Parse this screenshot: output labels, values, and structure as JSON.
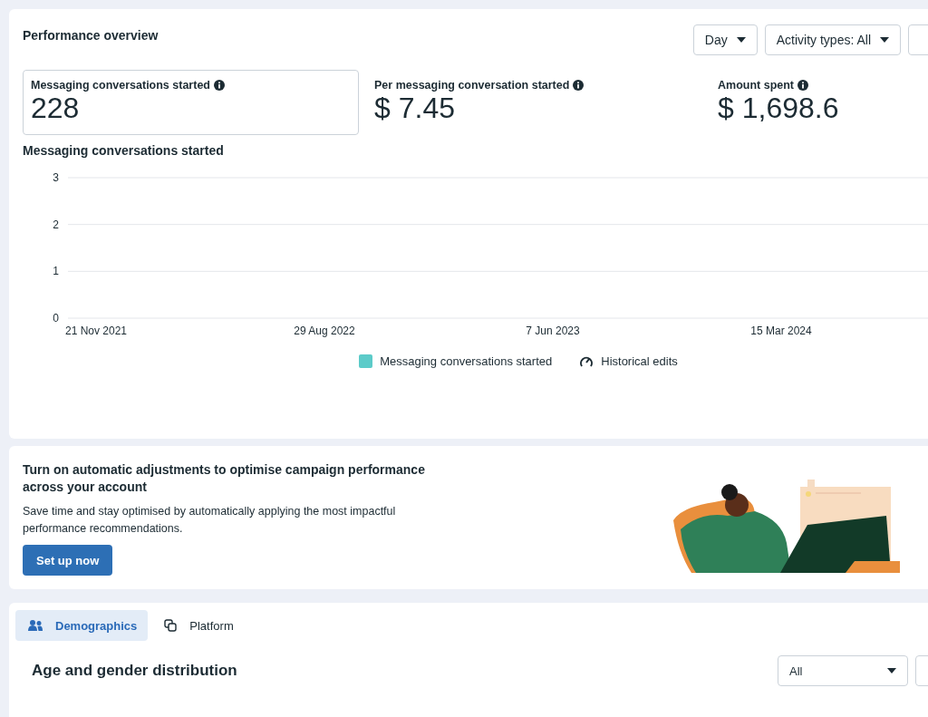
{
  "performance_overview": {
    "title": "Performance overview",
    "filters": [
      {
        "label": "Day"
      },
      {
        "label": "Activity types: All"
      }
    ],
    "metrics": [
      {
        "label": "Messaging conversations started",
        "value": "228",
        "selected": true
      },
      {
        "label": "Per messaging conversation started",
        "value": "$ 7.45",
        "selected": false
      },
      {
        "label": "Amount spent",
        "value": "$ 1,698.6",
        "selected": false
      }
    ],
    "chart": {
      "title": "Messaging conversations started",
      "historical_edits_label": "Historical edits",
      "chart_data": {
        "type": "line",
        "categories": [
          "21 Nov 2021",
          "29 Aug 2022",
          "7 Jun 2023",
          "15 Mar 2024"
        ],
        "yticks": [
          0,
          1,
          2,
          3
        ],
        "ylim": [
          0,
          3
        ],
        "series": [
          {
            "name": "Messaging conversations started",
            "color": "#5ccbc9",
            "values": [
              null,
              null,
              null,
              null
            ]
          }
        ]
      }
    }
  },
  "recommendation": {
    "title": "Turn on automatic adjustments to optimise campaign performance across your account",
    "body": "Save time and stay optimised by automatically applying the most impactful performance recommendations.",
    "button": "Set up now"
  },
  "breakdown": {
    "tabs": [
      {
        "label": "Demographics",
        "kind": "people",
        "selected": true
      },
      {
        "label": "Platform",
        "kind": "platform",
        "selected": false
      }
    ],
    "title": "Age and gender distribution",
    "dropdown": {
      "value": "All"
    }
  }
}
